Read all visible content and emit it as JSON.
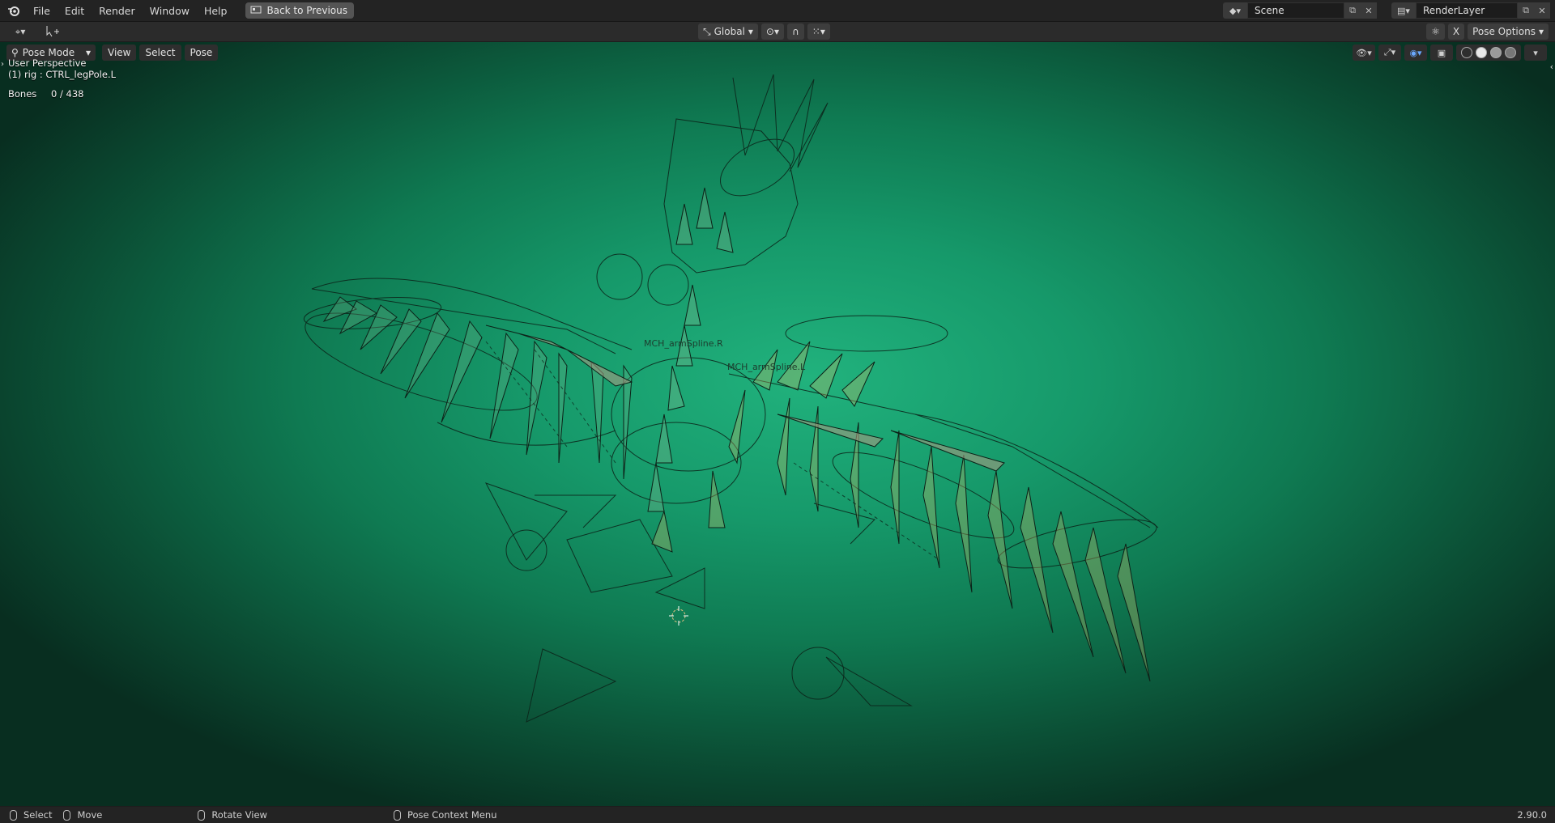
{
  "menubar": {
    "items": [
      "File",
      "Edit",
      "Render",
      "Window",
      "Help"
    ],
    "back_button": "Back to Previous"
  },
  "scene": {
    "name": "Scene"
  },
  "render_layer": {
    "name": "RenderLayer"
  },
  "toolheader": {
    "orientation": "Global",
    "x_button": "X",
    "pose_options": "Pose Options"
  },
  "viewport_header": {
    "mode": "Pose Mode",
    "menus": [
      "View",
      "Select",
      "Pose"
    ]
  },
  "overlay": {
    "perspective": "User Perspective",
    "object": "(1) rig : CTRL_legPole.L",
    "bones_label": "Bones",
    "bones_value": "0 / 438"
  },
  "bone_labels": [
    "MCH_armSpline.R",
    "MCH_armSpline.L"
  ],
  "statusbar": {
    "select": "Select",
    "move": "Move",
    "rotate": "Rotate View",
    "context": "Pose Context Menu",
    "version": "2.90.0"
  },
  "colors": {
    "viewport_center": "#21b27d",
    "viewport_edge": "#082e20",
    "header": "#232323"
  }
}
